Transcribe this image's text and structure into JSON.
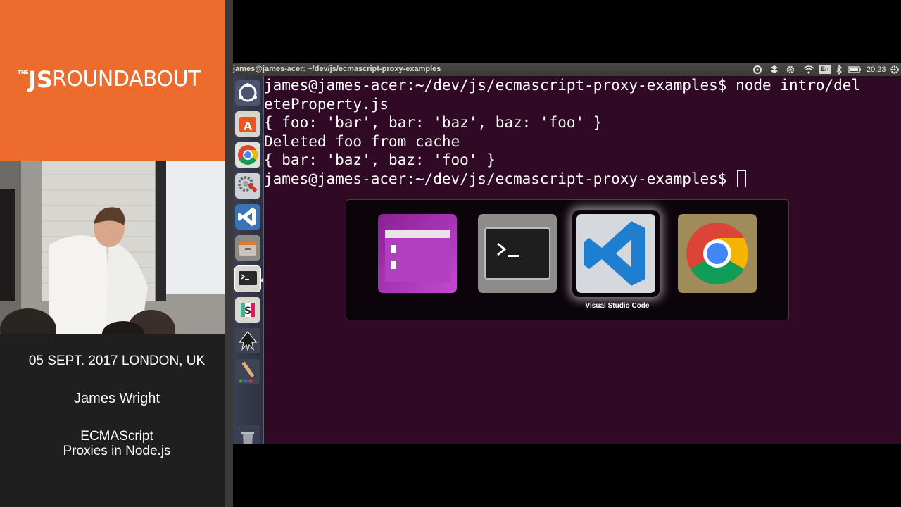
{
  "conference": {
    "brand_the": "THE",
    "brand_js": "JS",
    "brand_rest": "ROUNDABOUT",
    "date_location": "05 SEPT. 2017 LONDON, UK",
    "speaker": "James Wright",
    "talk_title_line1": "ECMAScript",
    "talk_title_line2": "Proxies in Node.js",
    "brand_color": "#ec6b2d"
  },
  "top_bar": {
    "window_title": "james@james-acer: ~/dev/js/ecmascript-proxy-examples",
    "keyboard_layout": "En",
    "clock": "20:23",
    "tray_icons": [
      "dropbox-icon",
      "network-icon",
      "settings-icon",
      "wifi-icon",
      "keyboard-icon",
      "bluetooth-icon",
      "battery-icon",
      "power-icon"
    ]
  },
  "launcher": {
    "items": [
      {
        "name": "ubuntu-dash-icon"
      },
      {
        "name": "software-center-icon"
      },
      {
        "name": "chrome-icon"
      },
      {
        "name": "system-settings-icon"
      },
      {
        "name": "vscode-icon"
      },
      {
        "name": "file-manager-icon"
      },
      {
        "name": "terminal-icon",
        "active": true
      },
      {
        "name": "slack-icon"
      },
      {
        "name": "inkscape-icon"
      },
      {
        "name": "paint-icon"
      },
      {
        "name": "trash-icon"
      }
    ]
  },
  "terminal": {
    "lines": [
      "james@james-acer:~/dev/js/ecmascript-proxy-examples$ node intro/del",
      "eteProperty.js",
      "{ foo: 'bar', bar: 'baz', baz: 'foo' }",
      "Deleted foo from cache",
      "{ bar: 'baz', baz: 'foo' }",
      "james@james-acer:~/dev/js/ecmascript-proxy-examples$ "
    ],
    "background": "#300a24"
  },
  "switcher": {
    "items": [
      "files-icon",
      "terminal-icon",
      "vscode-icon",
      "chrome-icon"
    ],
    "selected_label": "Visual Studio Code"
  }
}
